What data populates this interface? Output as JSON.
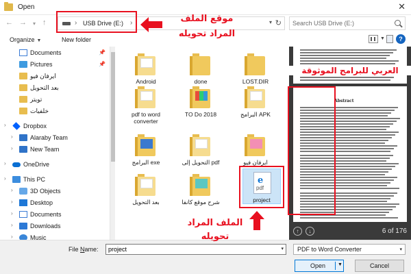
{
  "window": {
    "title": "Open",
    "close_glyph": "✕"
  },
  "address": {
    "back_glyph": "←",
    "forward_glyph": "→",
    "up_glyph": "↑",
    "path": [
      "USB Drive (E:)"
    ],
    "separator": "›",
    "dropdown_glyph": "▾",
    "refresh_glyph": "↻",
    "search_placeholder": "Search USB Drive (E:)"
  },
  "toolbar": {
    "organize_label": "Organize",
    "dropdown_glyph": "▼",
    "new_folder_label": "New folder",
    "help_label": "?"
  },
  "sidebar": {
    "pin_glyph": "📌",
    "chevron_glyph": "›",
    "items": [
      {
        "label": "Documents",
        "icon": "documents-icon",
        "pinned": true
      },
      {
        "label": "Pictures",
        "icon": "pictures-icon",
        "pinned": true
      },
      {
        "label": "ايرفان فيو",
        "icon": "folder-icon"
      },
      {
        "label": "بعد التحويل",
        "icon": "folder-icon"
      },
      {
        "label": "تويتر",
        "icon": "folder-icon"
      },
      {
        "label": "خلفيات",
        "icon": "folder-icon"
      },
      {
        "label": "Dropbox",
        "icon": "dropbox-icon"
      },
      {
        "label": "Alaraby Team",
        "icon": "dropbox-folder-icon"
      },
      {
        "label": "New Team",
        "icon": "dropbox-folder-icon"
      },
      {
        "label": "OneDrive",
        "icon": "onedrive-icon"
      },
      {
        "label": "This PC",
        "icon": "pc-icon"
      },
      {
        "label": "3D Objects",
        "icon": "3d-objects-icon"
      },
      {
        "label": "Desktop",
        "icon": "desktop-icon"
      },
      {
        "label": "Documents",
        "icon": "documents-icon"
      },
      {
        "label": "Downloads",
        "icon": "downloads-icon"
      },
      {
        "label": "Music",
        "icon": "music-icon"
      }
    ]
  },
  "files": [
    {
      "name": "Android",
      "type": "folder"
    },
    {
      "name": "done",
      "type": "folder"
    },
    {
      "name": "LOST.DIR",
      "type": "folder"
    },
    {
      "name": "pdf to word converter",
      "type": "folder"
    },
    {
      "name": "TO Do 2018",
      "type": "folder"
    },
    {
      "name": "البرامج APK",
      "type": "folder"
    },
    {
      "name": "البرامج exe",
      "type": "folder"
    },
    {
      "name": "التحويل إلى pdf",
      "type": "folder"
    },
    {
      "name": "ايرفان فيو",
      "type": "folder"
    },
    {
      "name": "بعد التحويل",
      "type": "folder"
    },
    {
      "name": "شرح موقع كانفا",
      "type": "folder"
    },
    {
      "name": "project",
      "type": "pdf",
      "icon_text": "pdf",
      "selected": true
    }
  ],
  "preview": {
    "heading": "Abstract",
    "page_count": "6 of 176",
    "up_glyph": "↑",
    "down_glyph": "↓"
  },
  "bottom": {
    "file_name_label_u": "N",
    "file_name_label_rest": "ame:",
    "file_name_label_prefix": "File ",
    "file_name_value": "project",
    "dropdown_glyph": "▾",
    "file_type": "PDF to Word Converter",
    "open_label": "Open",
    "cancel_label": "Cancel"
  },
  "annotations": {
    "location_title": "موقع الملف",
    "location_subtitle": "المراد تحويله",
    "trusted": "العربي للبرامج الموثوقة",
    "file_title": "الملف المراد",
    "file_subtitle": "تحويله",
    "color": "#e8101f"
  }
}
